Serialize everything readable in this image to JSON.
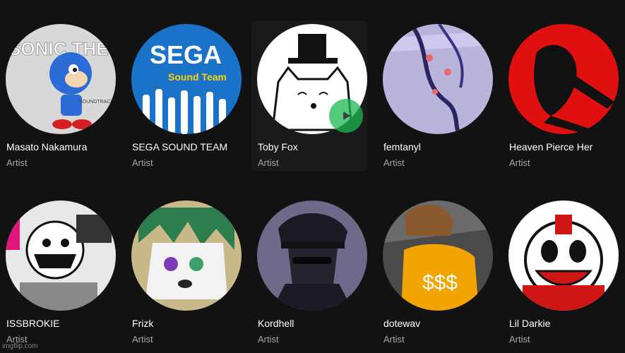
{
  "artists": [
    {
      "name": "Masato Nakamura",
      "type": "Artist",
      "cover_text": "SONIC THE HEDGEHOG",
      "cover_sub": "SOUNDTRACK"
    },
    {
      "name": "SEGA SOUND TEAM",
      "type": "Artist",
      "cover_text": "SEGA",
      "cover_sub": "Sound Team"
    },
    {
      "name": "Toby Fox",
      "type": "Artist"
    },
    {
      "name": "femtanyl",
      "type": "Artist"
    },
    {
      "name": "Heaven Pierce Her",
      "type": "Artist"
    },
    {
      "name": "ISSBROKIE",
      "type": "Artist"
    },
    {
      "name": "Frizk",
      "type": "Artist"
    },
    {
      "name": "Kordhell",
      "type": "Artist"
    },
    {
      "name": "dotewav",
      "type": "Artist",
      "cover_text": "$$$"
    },
    {
      "name": "Lil Darkie",
      "type": "Artist"
    }
  ],
  "watermark": "imgflip.com",
  "colors": {
    "background": "#121212",
    "play_button": "#1db954",
    "secondary_text": "#a7a7a7"
  },
  "icons": {
    "play": "play-icon"
  }
}
